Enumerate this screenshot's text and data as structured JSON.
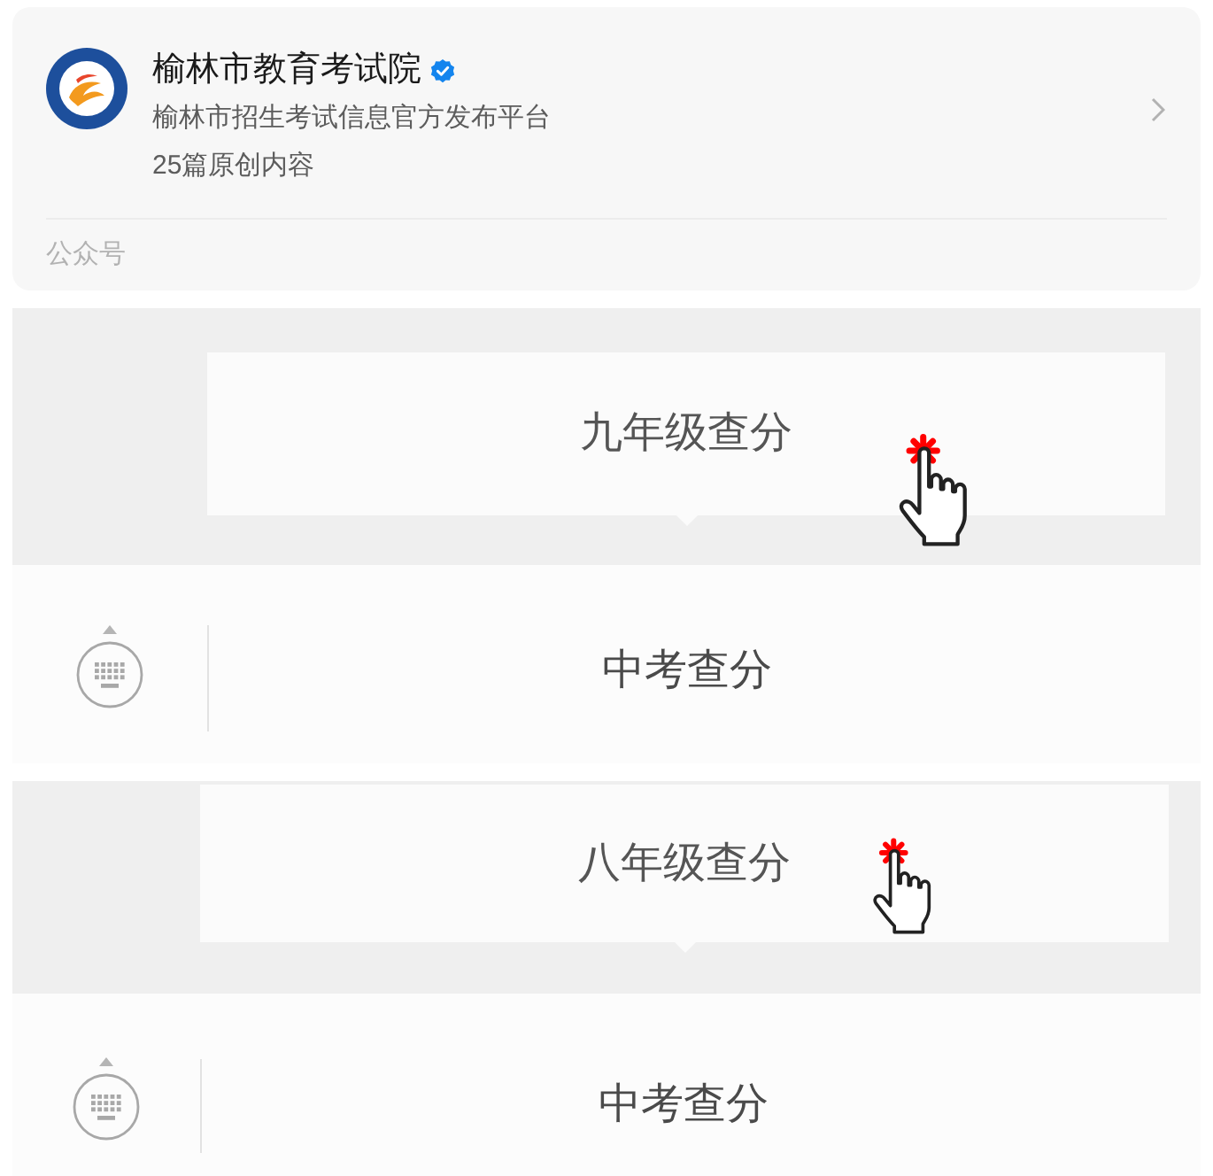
{
  "account": {
    "name": "榆林市教育考试院",
    "verified": true,
    "description": "榆林市招生考试信息官方发布平台",
    "original_count": "25篇原创内容",
    "type_label": "公众号"
  },
  "menu_screenshots": [
    {
      "submenu_item": "九年级查分",
      "menu_button": "中考查分"
    },
    {
      "submenu_item": "八年级查分",
      "menu_button": "中考查分"
    }
  ]
}
